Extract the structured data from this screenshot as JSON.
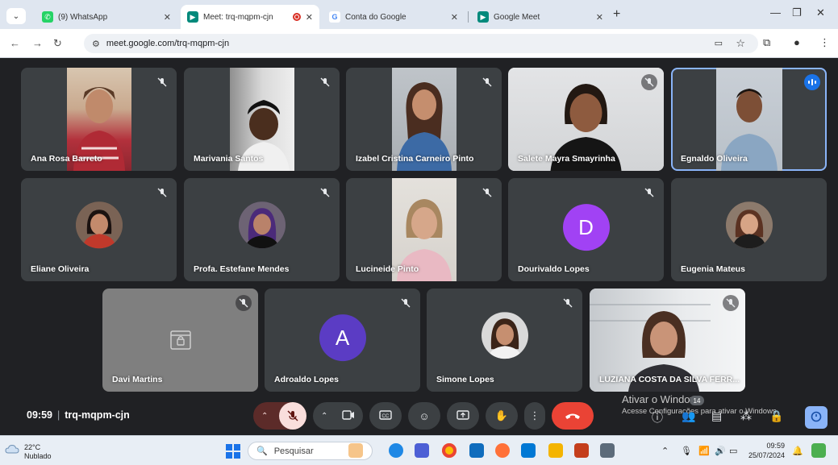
{
  "browser": {
    "tabs": [
      {
        "label": "(9) WhatsApp",
        "icon": "whatsapp-icon",
        "color": "#25d366",
        "active": false
      },
      {
        "label": "Meet: trq-mqpm-cjn",
        "icon": "meet-icon",
        "color": "#00897b",
        "active": true,
        "recording": true
      },
      {
        "label": "Conta do Google",
        "icon": "google-icon",
        "color": "#4285f4",
        "active": false
      },
      {
        "label": "Google Meet",
        "icon": "meet-icon",
        "color": "#00897b",
        "active": false
      }
    ],
    "url": "meet.google.com/trq-mqpm-cjn"
  },
  "meeting": {
    "time": "09:59",
    "code": "trq-mqpm-cjn",
    "participant_count": "14"
  },
  "participants": [
    {
      "name": "Ana Rosa Barreto",
      "type": "video",
      "muted": true
    },
    {
      "name": "Marivania Santos",
      "type": "video",
      "muted": true
    },
    {
      "name": "Izabel Cristina Carneiro Pinto",
      "type": "video",
      "muted": true
    },
    {
      "name": "Salete Mayra Smayrinha",
      "type": "video",
      "muted": true
    },
    {
      "name": "Egnaldo Oliveira",
      "type": "video",
      "muted": false,
      "speaking": true
    },
    {
      "name": "Eliane Oliveira",
      "type": "photo",
      "muted": true
    },
    {
      "name": "Profa. Estefane Mendes",
      "type": "photo",
      "muted": true
    },
    {
      "name": "Lucineide Pinto",
      "type": "video",
      "muted": true
    },
    {
      "name": "Dourivaldo Lopes",
      "type": "letter",
      "letter": "D",
      "color": "#a142f4",
      "muted": true
    },
    {
      "name": "Eugenia Mateus",
      "type": "photo",
      "muted": false
    },
    {
      "name": "Davi Martins",
      "type": "locked",
      "muted": true
    },
    {
      "name": "Adroaldo Lopes",
      "type": "letter",
      "letter": "A",
      "color": "#5b3cc4",
      "muted": true
    },
    {
      "name": "Simone Lopes",
      "type": "photo",
      "muted": true
    },
    {
      "name": "LUZIANA COSTA DA SILVA FERR...",
      "type": "video",
      "muted": true
    }
  ],
  "watermark": {
    "title": "Ativar o Windows",
    "subtitle": "Acesse Configurações para ativar o Windows."
  },
  "taskbar": {
    "temperature": "22°C",
    "weather": "Nublado",
    "search_placeholder": "Pesquisar",
    "time": "09:59",
    "date": "25/07/2024"
  },
  "colors": {
    "meet_bg": "#202124",
    "tile_bg": "#3c4043",
    "hangup": "#ea4335",
    "accent": "#1a73e8"
  }
}
